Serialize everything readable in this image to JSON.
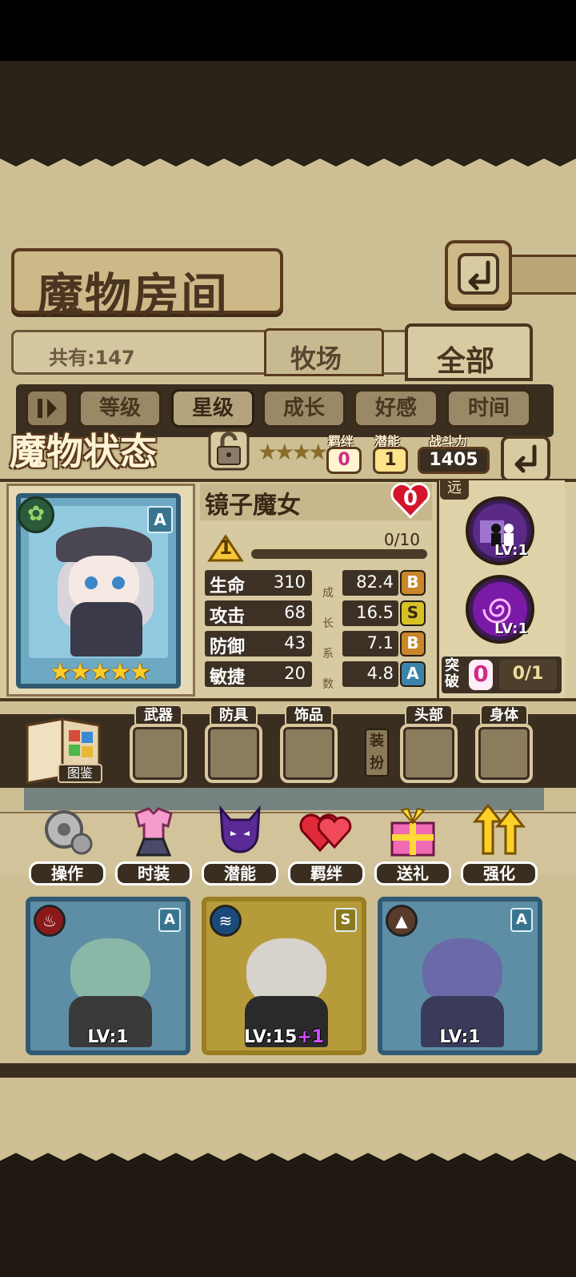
{
  "header": {
    "title": "魔物房间",
    "count_label": "共有:147",
    "tabs": [
      {
        "label": "牧场"
      },
      {
        "label": "全部"
      }
    ]
  },
  "sort": {
    "options": [
      {
        "label": "等级"
      },
      {
        "label": "星级"
      },
      {
        "label": "成长"
      },
      {
        "label": "好感"
      },
      {
        "label": "时间"
      }
    ],
    "active": "星级"
  },
  "status": {
    "title": "魔物状态",
    "bond_label": "羁绊",
    "bond_value": "0",
    "potential_label": "潜能",
    "potential_value": "1",
    "power_label": "战斗力",
    "power_value": "1405"
  },
  "monster": {
    "name": "镜子魔女",
    "favor": "0",
    "rank": "A",
    "element": "leaf-icon",
    "stars": "★★★★★",
    "level": "1",
    "exp_text": "0/10",
    "exp_fraction": 0.0,
    "range_tag": "远",
    "stats": [
      {
        "label": "生命",
        "value": "310",
        "growth": "82.4",
        "grade": "B"
      },
      {
        "label": "攻击",
        "value": "68",
        "growth": "16.5",
        "grade": "S"
      },
      {
        "label": "防御",
        "value": "43",
        "growth": "7.1",
        "grade": "B"
      },
      {
        "label": "敏捷",
        "value": "20",
        "growth": "4.8",
        "grade": "A"
      }
    ],
    "growth_vertical": [
      "成",
      "长",
      "系",
      "数"
    ],
    "skills": [
      {
        "level": "LV:1"
      },
      {
        "level": "LV:1"
      }
    ],
    "breakthrough_label": "突破",
    "breakthrough_value": "0",
    "breakthrough_progress": "0/1"
  },
  "equipment": {
    "book_label": "图鉴",
    "slots": [
      {
        "label": "武器"
      },
      {
        "label": "防具"
      },
      {
        "label": "饰品"
      },
      {
        "label": "头部"
      },
      {
        "label": "身体"
      }
    ],
    "dress_label": "装扮"
  },
  "actions": [
    {
      "label": "操作",
      "icon": "gear-icon"
    },
    {
      "label": "时装",
      "icon": "outfit-icon"
    },
    {
      "label": "潜能",
      "icon": "demon-icon"
    },
    {
      "label": "羁绊",
      "icon": "hearts-icon"
    },
    {
      "label": "送礼",
      "icon": "gift-icon"
    },
    {
      "label": "强化",
      "icon": "upgrade-arrows-icon"
    }
  ],
  "cards": [
    {
      "level": "LV:1",
      "plus": "",
      "rank": "A",
      "element": "fire-icon"
    },
    {
      "level": "LV:15",
      "plus": "+1",
      "rank": "S",
      "element": "water-icon"
    },
    {
      "level": "LV:1",
      "plus": "",
      "rank": "A",
      "element": "earth-icon"
    }
  ],
  "colors": {
    "panel": "#cdbf93",
    "dark_wood": "#3a2e20",
    "accent_pink": "#d02a8a",
    "gold": "#ffcd28"
  }
}
